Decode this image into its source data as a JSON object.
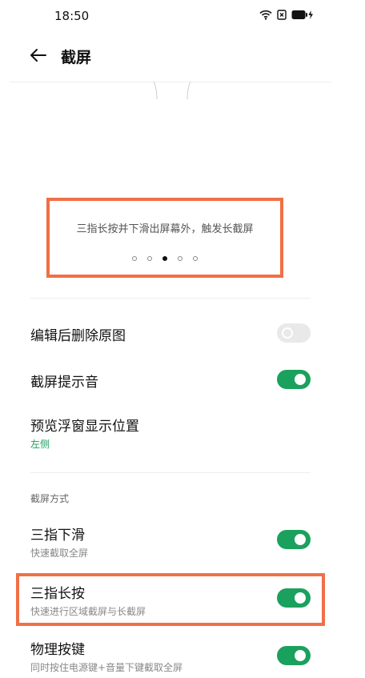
{
  "status_bar": {
    "time": "18:50"
  },
  "header": {
    "title": "截屏"
  },
  "preview": {
    "caption": "三指长按并下滑出屏幕外，触发长截屏",
    "dot_count": 5,
    "active_dot": 3
  },
  "settings": {
    "delete_after_edit": {
      "title": "编辑后删除原图",
      "enabled": false
    },
    "screenshot_sound": {
      "title": "截屏提示音",
      "enabled": true
    },
    "preview_position": {
      "title": "预览浮窗显示位置",
      "value": "左侧"
    }
  },
  "section": {
    "label": "截屏方式"
  },
  "methods": [
    {
      "title": "三指下滑",
      "subtitle": "快速截取全屏",
      "enabled": true
    },
    {
      "title": "三指长按",
      "subtitle": "快速进行区域截屏与长截屏",
      "enabled": true
    },
    {
      "title": "物理按键",
      "subtitle": "同时按住电源键+音量下键截取全屏",
      "enabled": true
    }
  ],
  "colors": {
    "accent": "#1aa15d",
    "highlight": "#f07046"
  }
}
